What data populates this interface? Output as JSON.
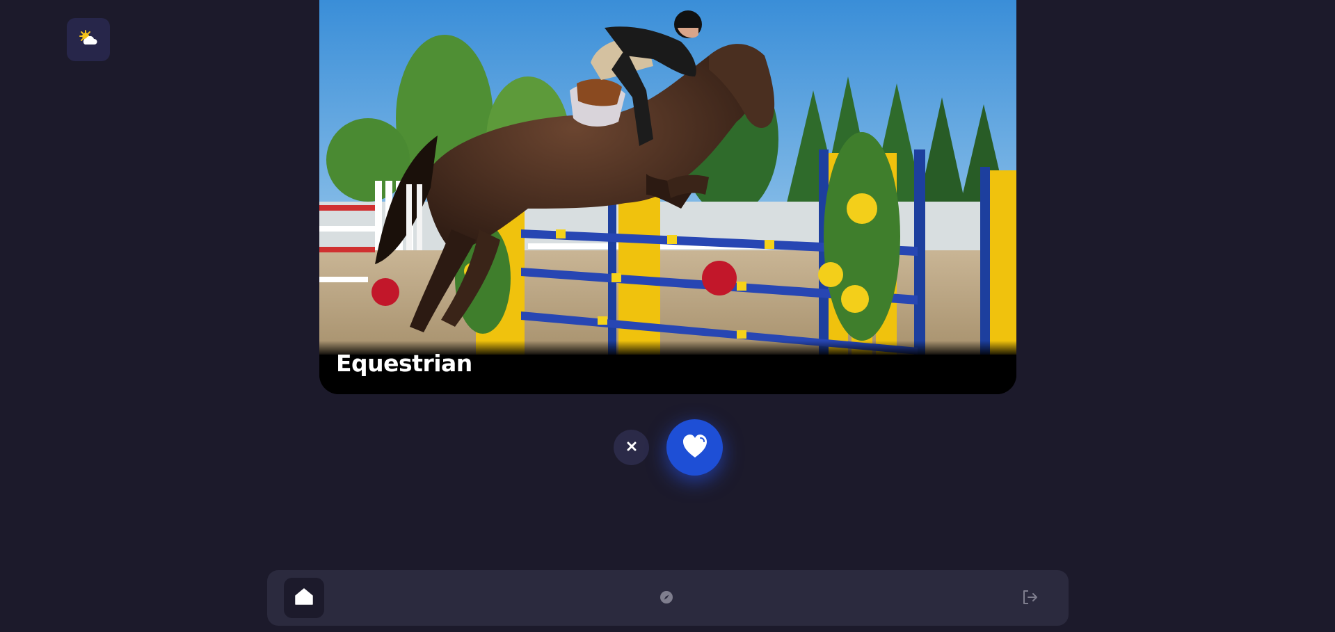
{
  "weather": {
    "icon": "partly-sunny-icon"
  },
  "card": {
    "title": "Equestrian",
    "image_subject": "horse-show-jumping-photo"
  },
  "actions": {
    "dismiss_icon": "close-icon",
    "like_icon": "heart-icon"
  },
  "nav": {
    "home_icon": "home-icon",
    "explore_icon": "compass-icon",
    "logout_icon": "logout-icon"
  },
  "colors": {
    "background": "#1c1a2b",
    "accent": "#1e4fd6",
    "nav_bar": "#2b2a3e"
  }
}
